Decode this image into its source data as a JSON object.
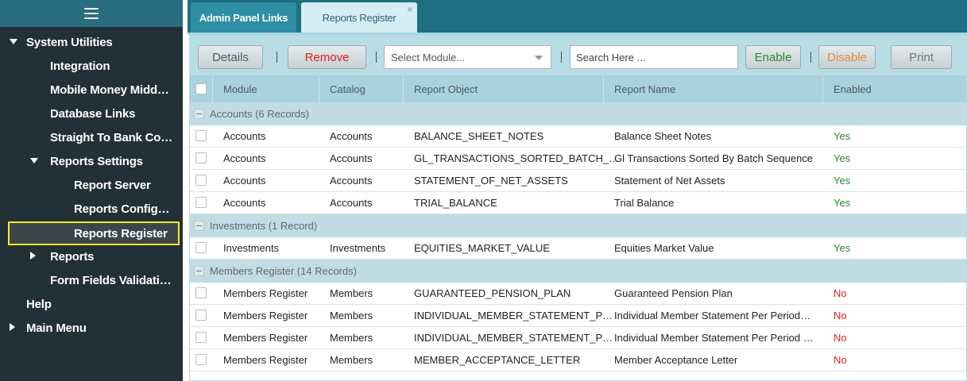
{
  "sidebar": {
    "items": [
      {
        "label": "System Utilities",
        "arrow": "down",
        "level": 0
      },
      {
        "label": "Integration",
        "arrow": "",
        "level": 1
      },
      {
        "label": "Mobile Money Midd…",
        "arrow": "",
        "level": 1
      },
      {
        "label": "Database Links",
        "arrow": "",
        "level": 1
      },
      {
        "label": "Straight To Bank Co…",
        "arrow": "",
        "level": 1
      },
      {
        "label": "Reports Settings",
        "arrow": "down",
        "level": 1
      },
      {
        "label": "Report Server",
        "arrow": "",
        "level": 2
      },
      {
        "label": "Reports Config…",
        "arrow": "",
        "level": 2
      },
      {
        "label": "Reports Register",
        "arrow": "",
        "level": 2,
        "active": true
      },
      {
        "label": "Reports",
        "arrow": "right",
        "level": 1
      },
      {
        "label": "Form Fields Validati…",
        "arrow": "",
        "level": 1
      },
      {
        "label": "Help",
        "arrow": "",
        "level": 0
      },
      {
        "label": "Main Menu",
        "arrow": "right",
        "level": 0
      }
    ]
  },
  "tabs": [
    {
      "label": "Admin Panel Links"
    },
    {
      "label": "Reports Register",
      "active": true,
      "close": "×"
    }
  ],
  "toolbar": {
    "details_label": "Details",
    "remove_label": "Remove",
    "select_module_placeholder": "Select Module...",
    "search_placeholder": "Search Here ...",
    "enable_label": "Enable",
    "disable_label": "Disable",
    "print_label": "Print"
  },
  "grid": {
    "columns": [
      "Module",
      "Catalog",
      "Report Object",
      "Report Name",
      "Enabled"
    ],
    "groups": [
      {
        "label": "Accounts (6 Records)",
        "rows": [
          {
            "module": "Accounts",
            "catalog": "Accounts",
            "object": "BALANCE_SHEET_NOTES",
            "name": "Balance Sheet Notes",
            "enabled": "Yes"
          },
          {
            "module": "Accounts",
            "catalog": "Accounts",
            "object": "GL_TRANSACTIONS_SORTED_BATCH_…",
            "name": "Gl Transactions Sorted By Batch Sequence",
            "enabled": "Yes"
          },
          {
            "module": "Accounts",
            "catalog": "Accounts",
            "object": "STATEMENT_OF_NET_ASSETS",
            "name": "Statement of Net Assets",
            "enabled": "Yes"
          },
          {
            "module": "Accounts",
            "catalog": "Accounts",
            "object": "TRIAL_BALANCE",
            "name": "Trial Balance",
            "enabled": "Yes"
          }
        ]
      },
      {
        "label": "Investments (1 Record)",
        "rows": [
          {
            "module": "Investments",
            "catalog": "Investments",
            "object": "EQUITIES_MARKET_VALUE",
            "name": "Equities Market Value",
            "enabled": "Yes"
          }
        ]
      },
      {
        "label": "Members Register (14 Records)",
        "rows": [
          {
            "module": "Members Register",
            "catalog": "Members",
            "object": "GUARANTEED_PENSION_PLAN",
            "name": "Guaranteed Pension Plan",
            "enabled": "No"
          },
          {
            "module": "Members Register",
            "catalog": "Members",
            "object": "INDIVIDUAL_MEMBER_STATEMENT_P…",
            "name": "Individual Member Statement Per Period…",
            "enabled": "No"
          },
          {
            "module": "Members Register",
            "catalog": "Members",
            "object": "INDIVIDUAL_MEMBER_STATEMENT_P…",
            "name": "Individual Member Statement Per Period …",
            "enabled": "No"
          },
          {
            "module": "Members Register",
            "catalog": "Members",
            "object": "MEMBER_ACCEPTANCE_LETTER",
            "name": "Member Acceptance Letter",
            "enabled": "No"
          }
        ]
      }
    ]
  }
}
